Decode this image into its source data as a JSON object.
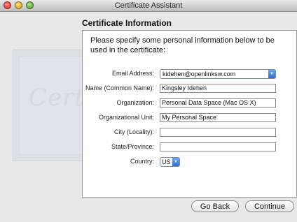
{
  "window": {
    "title": "Certificate Assistant"
  },
  "page": {
    "heading": "Certificate Information",
    "intro": "Please specify some personal information below to be used in the certificate:",
    "background_text": "Certif"
  },
  "form": {
    "email": {
      "label": "Email Address:",
      "value": "kidehen@openlinksw.com"
    },
    "common_name": {
      "label": "Name (Common Name):",
      "value": "Kingsley  Idehen"
    },
    "organization": {
      "label": "Organization:",
      "value": "Personal Data Space (Mac OS X)"
    },
    "org_unit": {
      "label": "Organizational Unit:",
      "value": "My Personal Space"
    },
    "city": {
      "label": "City (Locality):",
      "value": ""
    },
    "state": {
      "label": "State/Province:",
      "value": ""
    },
    "country": {
      "label": "Country:",
      "value": "US"
    }
  },
  "buttons": {
    "back": "Go Back",
    "continue": "Continue"
  },
  "icons": {
    "close": "close-icon",
    "minimize": "minimize-icon",
    "zoom": "zoom-icon",
    "dropdown": "chevron-down-icon"
  }
}
